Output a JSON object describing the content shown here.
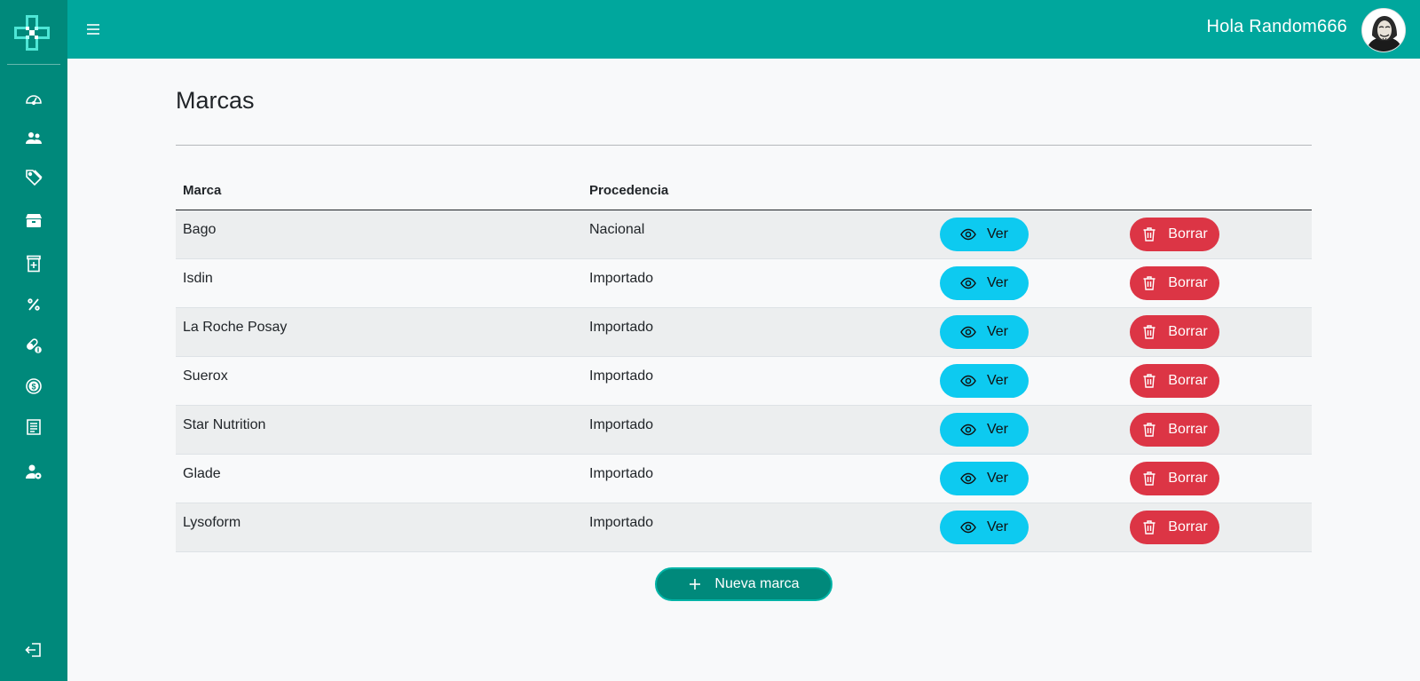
{
  "sidebar": {
    "logo_icon": "pharmacy-cross-icon",
    "items": [
      {
        "icon": "dashboard-gauge-icon"
      },
      {
        "icon": "users-icon"
      },
      {
        "icon": "tags-icon"
      },
      {
        "icon": "inventory-box-icon"
      },
      {
        "icon": "medicine-bottle-icon"
      },
      {
        "icon": "percent-icon"
      },
      {
        "icon": "pills-icon"
      },
      {
        "icon": "dollar-icon"
      },
      {
        "icon": "receipt-icon"
      },
      {
        "icon": "user-settings-icon"
      }
    ],
    "logout_icon": "logout-icon"
  },
  "header": {
    "greeting": "Hola Random666",
    "menu_icon": "hamburger-menu-icon",
    "avatar": "user-avatar"
  },
  "main": {
    "title": "Marcas",
    "table": {
      "columns": [
        "Marca",
        "Procedencia"
      ],
      "rows": [
        {
          "marca": "Bago",
          "procedencia": "Nacional"
        },
        {
          "marca": "Isdin",
          "procedencia": "Importado"
        },
        {
          "marca": "La Roche Posay",
          "procedencia": "Importado"
        },
        {
          "marca": "Suerox",
          "procedencia": "Importado"
        },
        {
          "marca": "Star Nutrition",
          "procedencia": "Importado"
        },
        {
          "marca": "Glade",
          "procedencia": "Importado"
        },
        {
          "marca": "Lysoform",
          "procedencia": "Importado"
        }
      ],
      "view_label": "Ver",
      "delete_label": "Borrar"
    },
    "new_button_label": "Nueva marca"
  },
  "colors": {
    "sidebar": "#00897b",
    "header": "#00a79d",
    "view_button": "#0dcaf0",
    "delete_button": "#dc3545",
    "new_button": "#00897b"
  }
}
